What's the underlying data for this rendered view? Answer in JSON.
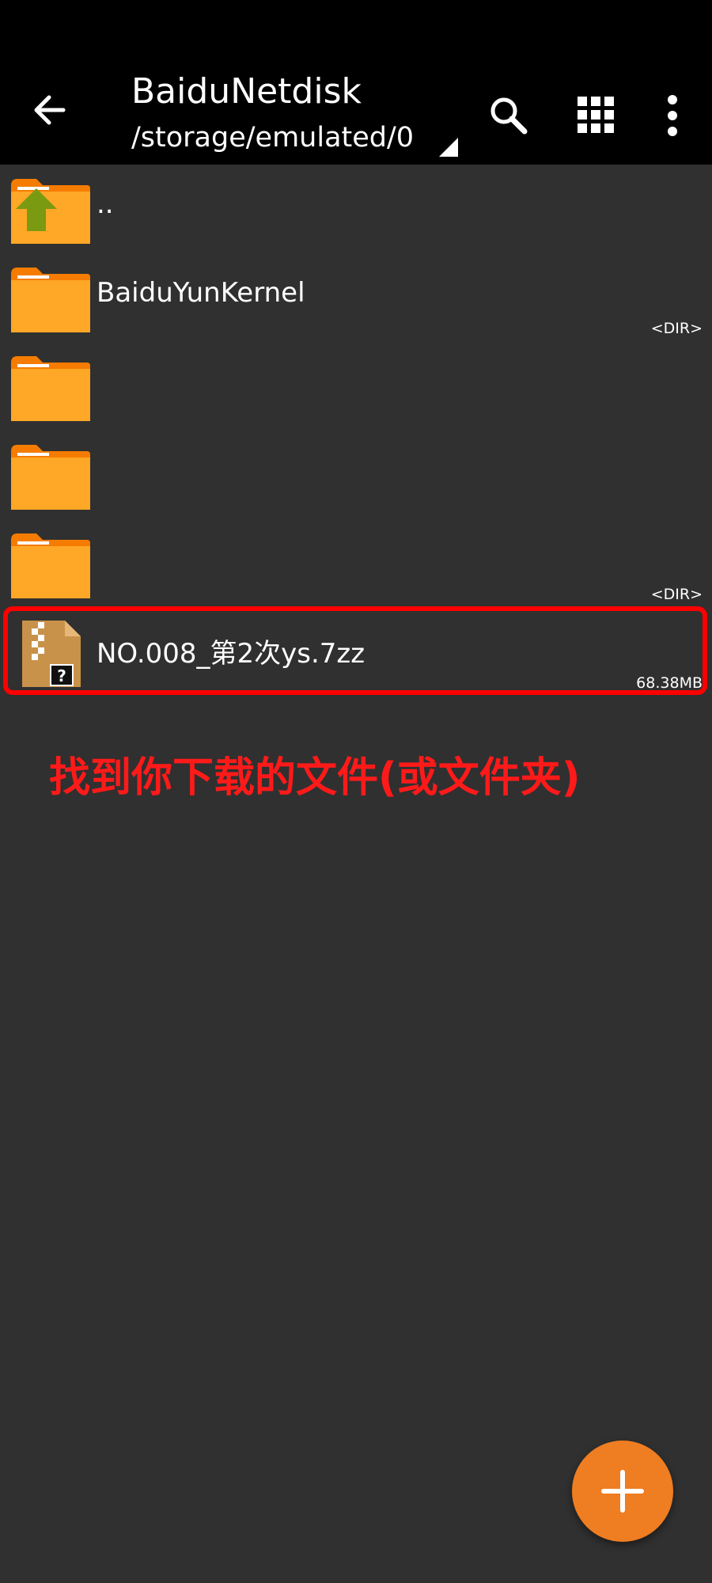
{
  "app_bar": {
    "title": "BaiduNetdisk",
    "path": "/storage/emulated/0",
    "icons": [
      "back-arrow-icon",
      "search-icon",
      "grid-view-icon",
      "more-vert-icon"
    ]
  },
  "files": [
    {
      "name": "..",
      "meta": "",
      "type": "parent-folder"
    },
    {
      "name": "BaiduYunKernel",
      "meta": "<DIR>",
      "type": "folder"
    },
    {
      "name": "",
      "meta": "",
      "type": "folder"
    },
    {
      "name": "",
      "meta": "",
      "type": "folder"
    },
    {
      "name": "",
      "meta": "<DIR>",
      "type": "folder"
    },
    {
      "name": "NO.008_第2次ys.7zz",
      "meta": "68.38MB",
      "type": "archive"
    }
  ],
  "annotation": "找到你下载的文件(或文件夹)",
  "colors": {
    "background": "#303030",
    "app_bar": "#000000",
    "folder": "#ffa726",
    "highlight": "#ff0000",
    "fab": "#ef7d22"
  },
  "fab": {
    "icon": "plus-icon"
  }
}
